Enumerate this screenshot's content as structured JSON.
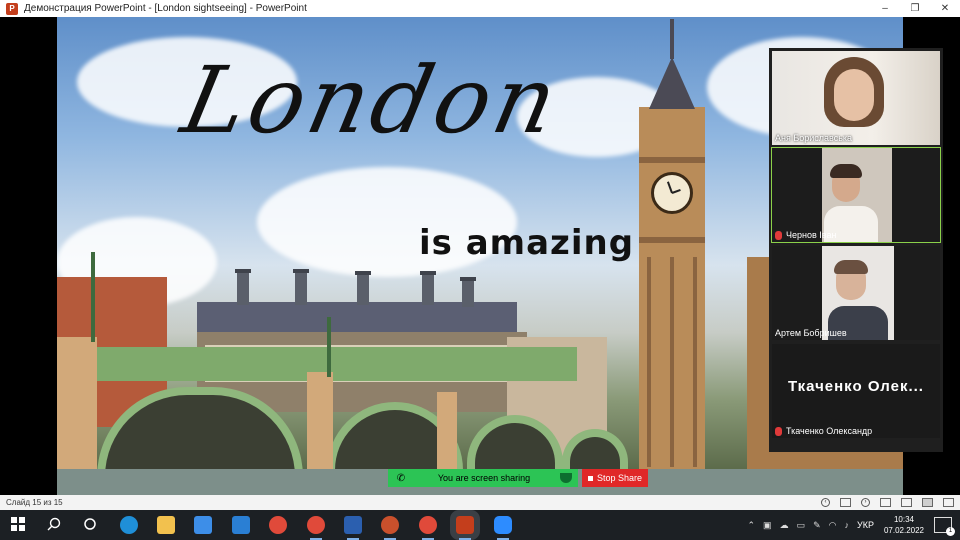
{
  "window": {
    "app_icon_letter": "P",
    "title": "Демонстрация PowerPoint - [London sightseeing] - PowerPoint",
    "controls": [
      "–",
      "❐",
      "✕"
    ]
  },
  "slide": {
    "title": "London",
    "subtitle": "is amazing"
  },
  "zoom": {
    "share_banner": "You are screen sharing",
    "stop_share": "Stop Share",
    "participants": [
      {
        "name": "Аня Бориславська",
        "muted": false,
        "video": true
      },
      {
        "name": "Чернов Іван",
        "muted": true,
        "video": true,
        "active": true
      },
      {
        "name": "Артем Бобришев",
        "muted": false,
        "video": true
      },
      {
        "name": "Ткаченко Олександр",
        "muted": true,
        "video": false,
        "display_name": "Ткаченко Олек..."
      }
    ]
  },
  "statusbar": {
    "slide_info": "Слайд 15 из 15"
  },
  "taskbar": {
    "apps": [
      {
        "name": "start",
        "color": "#1c2024",
        "running": false
      },
      {
        "name": "search",
        "color": "#1c2024",
        "running": false
      },
      {
        "name": "task-view",
        "color": "#1c2024",
        "running": false
      },
      {
        "name": "edge",
        "color": "#1f8fd8",
        "running": false
      },
      {
        "name": "file-explorer",
        "color": "#f2c14e",
        "running": false
      },
      {
        "name": "store",
        "color": "#3d8ee8",
        "running": false
      },
      {
        "name": "mail",
        "color": "#2a7fd4",
        "running": false
      },
      {
        "name": "chrome",
        "color": "#e04a3a",
        "running": false
      },
      {
        "name": "chrome-profile",
        "color": "#e04a3a",
        "running": true
      },
      {
        "name": "word",
        "color": "#2b5faf",
        "running": true
      },
      {
        "name": "media",
        "color": "#c9502c",
        "running": true
      },
      {
        "name": "chrome-2",
        "color": "#e04a3a",
        "running": true
      },
      {
        "name": "powerpoint",
        "color": "#c43e1c",
        "running": true
      },
      {
        "name": "zoom",
        "color": "#2d8cff",
        "running": true
      }
    ],
    "language": "УКР",
    "time": "10:34",
    "date": "07.02.2022",
    "notification_count": "1"
  }
}
